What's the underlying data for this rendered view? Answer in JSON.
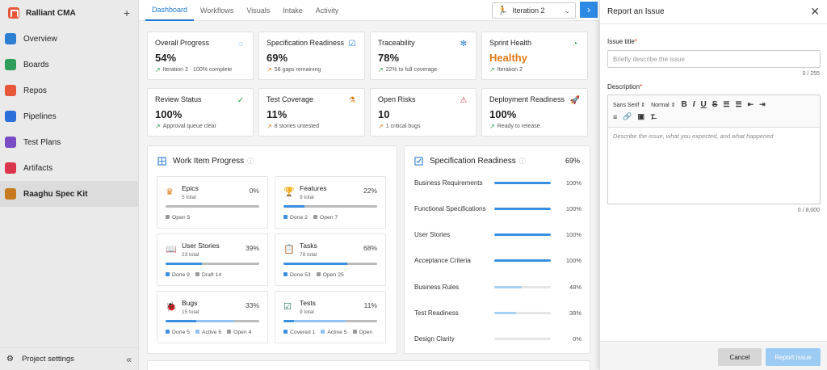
{
  "sidebar": {
    "org_name": "Ralliant CMA",
    "add_label": "+",
    "items": [
      {
        "label": "Overview",
        "icon": "overview-icon",
        "color": "#2d7fd4"
      },
      {
        "label": "Boards",
        "icon": "boards-icon",
        "color": "#2f9e5b"
      },
      {
        "label": "Repos",
        "icon": "repos-icon",
        "color": "#e8573a"
      },
      {
        "label": "Pipelines",
        "icon": "pipelines-icon",
        "color": "#2d6fd8"
      },
      {
        "label": "Test Plans",
        "icon": "test-plans-icon",
        "color": "#7a4bc4"
      },
      {
        "label": "Artifacts",
        "icon": "artifacts-icon",
        "color": "#d9364b"
      },
      {
        "label": "Raaghu Spec Kit",
        "icon": "spec-kit-icon",
        "color": "#c77a1e"
      }
    ],
    "footer_label": "Project settings",
    "collapse_label": "«"
  },
  "topbar": {
    "tabs": [
      "Dashboard",
      "Workflows",
      "Visuals",
      "Intake",
      "Activity"
    ],
    "iteration": "Iteration 2",
    "next_label": "›"
  },
  "stats": [
    {
      "title": "Overall Progress",
      "value": "54%",
      "sub": "Iteration 2 · 100% complete",
      "icon": "progress-ring-icon"
    },
    {
      "title": "Specification Readiness",
      "value": "69%",
      "sub": "58 gaps remaining",
      "icon": "checklist-icon"
    },
    {
      "title": "Traceability",
      "value": "78%",
      "sub": "22% to full coverage",
      "icon": "network-icon"
    },
    {
      "title": "Sprint Health",
      "value": "Healthy",
      "sub": "Iteration 2",
      "icon": "gauge-icon"
    },
    {
      "title": "Review Status",
      "value": "100%",
      "sub": "Approval queue clear",
      "icon": "check-circle-icon"
    },
    {
      "title": "Test Coverage",
      "value": "11%",
      "sub": "8 stories untested",
      "icon": "flask-icon"
    },
    {
      "title": "Open Risks",
      "value": "10",
      "sub": "1 critical bugs",
      "icon": "warning-icon"
    },
    {
      "title": "Deployment Readiness",
      "value": "100%",
      "sub": "Ready to release",
      "icon": "rocket-icon"
    }
  ],
  "work_items": {
    "title": "Work Item Progress",
    "cards": [
      {
        "name": "Epics",
        "total": "5 total",
        "pct": "0%",
        "legend": [
          {
            "label": "Open 5",
            "color": "#999"
          }
        ],
        "segments": [
          {
            "share": 0,
            "color": "#3b8fe0"
          }
        ]
      },
      {
        "name": "Features",
        "total": "9 total",
        "pct": "22%",
        "legend": [
          {
            "label": "Done 2",
            "color": "#3b8fe0"
          },
          {
            "label": "Open 7",
            "color": "#999"
          }
        ],
        "segments": [
          {
            "share": 0.22,
            "color": "#3b8fe0"
          }
        ]
      },
      {
        "name": "User Stories",
        "total": "23 total",
        "pct": "39%",
        "legend": [
          {
            "label": "Done 9",
            "color": "#3b8fe0"
          },
          {
            "label": "Draft 14",
            "color": "#999"
          }
        ],
        "segments": [
          {
            "share": 0.39,
            "color": "#3b8fe0"
          }
        ]
      },
      {
        "name": "Tasks",
        "total": "78 total",
        "pct": "68%",
        "legend": [
          {
            "label": "Done 53",
            "color": "#3b8fe0"
          },
          {
            "label": "Open 25",
            "color": "#999"
          }
        ],
        "segments": [
          {
            "share": 0.68,
            "color": "#3b8fe0"
          }
        ]
      },
      {
        "name": "Bugs",
        "total": "15 total",
        "pct": "33%",
        "legend": [
          {
            "label": "Done 5",
            "color": "#3b8fe0"
          },
          {
            "label": "Active 6",
            "color": "#8fc2f0"
          },
          {
            "label": "Open 4",
            "color": "#999"
          }
        ],
        "segments": [
          {
            "share": 0.33,
            "color": "#3b8fe0"
          },
          {
            "share": 0.4,
            "color": "#8fc2f0"
          }
        ]
      },
      {
        "name": "Tests",
        "total": "9 total",
        "pct": "11%",
        "legend": [
          {
            "label": "Covered 1",
            "color": "#3b8fe0"
          },
          {
            "label": "Active 5",
            "color": "#8fc2f0"
          },
          {
            "label": "Open",
            "color": "#999"
          }
        ],
        "segments": [
          {
            "share": 0.11,
            "color": "#3b8fe0"
          },
          {
            "share": 0.55,
            "color": "#8fc2f0"
          }
        ]
      }
    ]
  },
  "spec_readiness": {
    "title": "Specification Readiness",
    "pct": "69%",
    "rows": [
      {
        "label": "Business Requirements",
        "value": "100%",
        "level": 1.0,
        "color": "#3b8fe0"
      },
      {
        "label": "Functional Specifications",
        "value": "100%",
        "level": 1.0,
        "color": "#3b8fe0"
      },
      {
        "label": "User Stories",
        "value": "100%",
        "level": 1.0,
        "color": "#3b8fe0"
      },
      {
        "label": "Acceptance Criteria",
        "value": "100%",
        "level": 1.0,
        "color": "#3b8fe0"
      },
      {
        "label": "Business Rules",
        "value": "48%",
        "level": 0.48,
        "color": "#a8d0f3"
      },
      {
        "label": "Test Readiness",
        "value": "38%",
        "level": 0.38,
        "color": "#a8d0f3"
      },
      {
        "label": "Design Clarity",
        "value": "0%",
        "level": 0,
        "color": "#a8d0f3"
      }
    ]
  },
  "drawer": {
    "title": "Report an Issue",
    "close_label": "✕",
    "issue_title_label": "Issue title",
    "issue_title_placeholder": "Briefly describe the issue",
    "issue_title_counter": "0 / 255",
    "description_label": "Description",
    "font_select": "Sans Serif",
    "size_select": "Normal",
    "description_placeholder": "Describe the issue, what you expected, and what happened",
    "description_counter": "0 / 8,000",
    "cancel_label": "Cancel",
    "submit_label": "Report Issue"
  }
}
